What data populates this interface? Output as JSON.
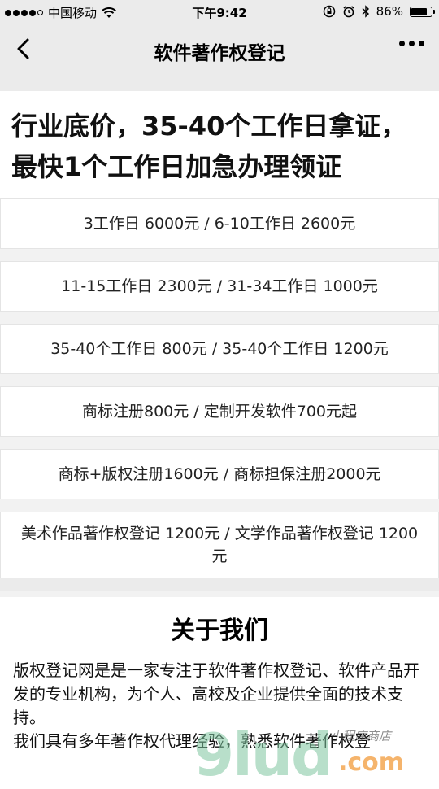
{
  "status_bar": {
    "carrier": "中国移动",
    "time": "下午9:42",
    "battery": "86%",
    "battery_level": 0.86
  },
  "nav": {
    "title": "软件著作权登记"
  },
  "headline": "行业底价，35-40个工作日拿证，最快1个工作日加急办理领证",
  "price_items": [
    "3工作日 6000元 / 6-10工作日 2600元",
    "11-15工作日 2300元 / 31-34工作日 1000元",
    "35-40个工作日 800元 / 35-40个工作日 1200元",
    "商标注册800元 / 定制开发软件700元起",
    "商标+版权注册1600元 / 商标担保注册2000元",
    "美术作品著作权登记 1200元 / 文学作品著作权登记 1200元"
  ],
  "about": {
    "title": "关于我们",
    "paragraph1": "版权登记网是是一家专注于软件著作权登记、软件产品开发的专业机构，为个人、高校及企业提供全面的技术支持。",
    "paragraph2": "我们具有多年著作权代理经验，熟悉软件著作权登"
  },
  "watermark": {
    "main": "9lud",
    "suffix": ".com",
    "tagline": "小程序商店"
  },
  "icons": {
    "back": "chevron-left-icon",
    "more": "more-dots-icon",
    "wifi": "wifi-icon",
    "lock": "orientation-lock-icon",
    "alarm": "alarm-icon",
    "bluetooth": "bluetooth-icon",
    "battery": "battery-icon"
  }
}
